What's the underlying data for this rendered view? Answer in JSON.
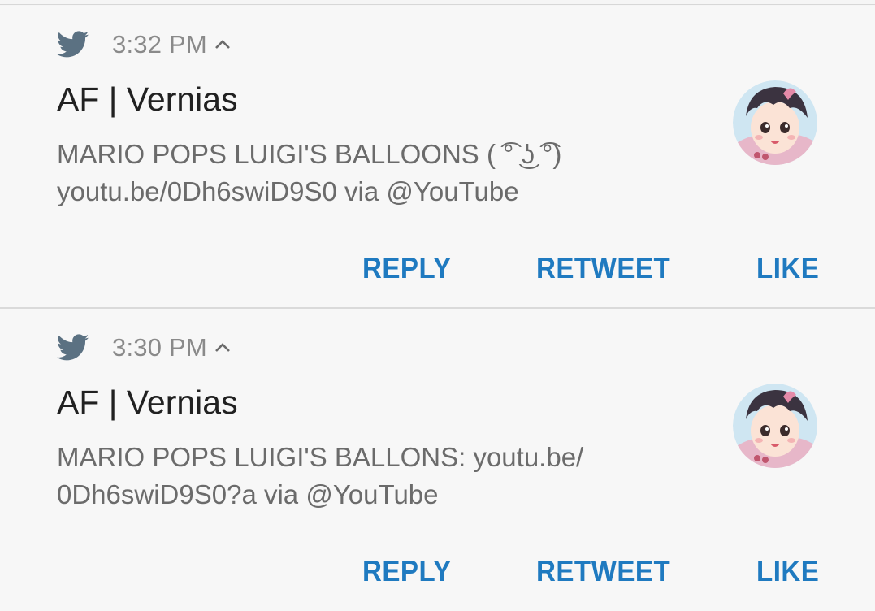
{
  "notifications": [
    {
      "icon": "twitter-bird-icon",
      "time": "3:32 PM",
      "expand_icon": "chevron-up-icon",
      "title": "AF | Vernias",
      "body_lines": [
        "MARIO POPS LUIGI'S BALLOONS ( ͡° ͜ʖ ͡°)",
        "youtu.be/0Dh6swiD9S0 via @YouTube"
      ],
      "avatar": "user-avatar",
      "actions": {
        "reply": "REPLY",
        "retweet": "RETWEET",
        "like": "LIKE"
      }
    },
    {
      "icon": "twitter-bird-icon",
      "time": "3:30 PM",
      "expand_icon": "chevron-up-icon",
      "title": "AF | Vernias",
      "body_lines": [
        "MARIO POPS LUIGI'S BALLONS: youtu.be/",
        "0Dh6swiD9S0?a via @YouTube"
      ],
      "avatar": "user-avatar",
      "actions": {
        "reply": "REPLY",
        "retweet": "RETWEET",
        "like": "LIKE"
      }
    }
  ],
  "colors": {
    "background": "#f7f7f7",
    "twitter_icon": "#5b7182",
    "time": "#8a8a8a",
    "title": "#212121",
    "body": "#6b6b6b",
    "action": "#1f7ac0",
    "divider": "#dadada"
  }
}
